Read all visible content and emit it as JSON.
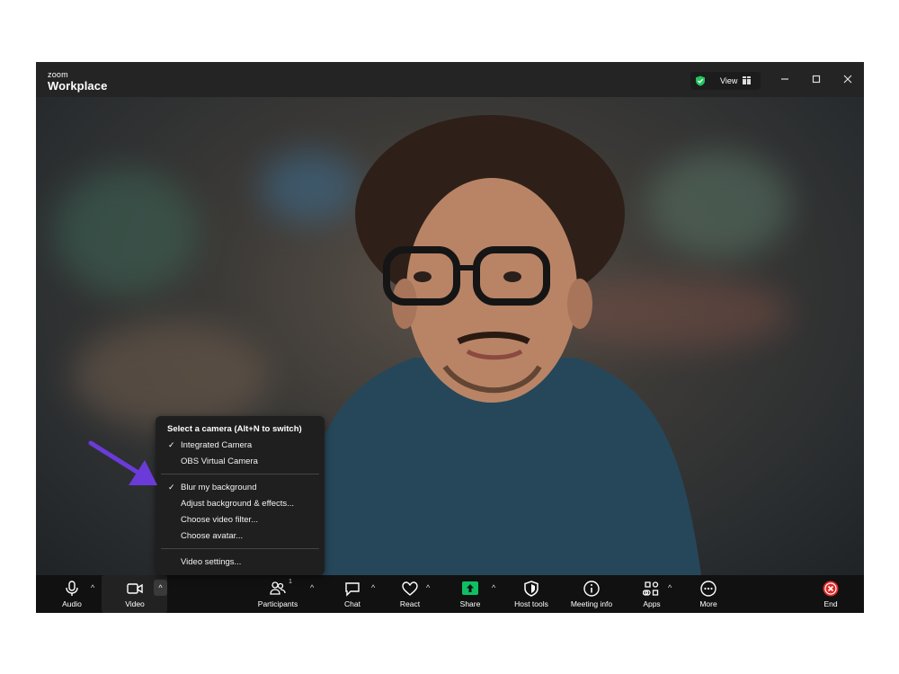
{
  "app": {
    "logo_small": "zoom",
    "logo_big": "Workplace"
  },
  "titlebar": {
    "view_label": "View",
    "icons": [
      "shield-check-icon",
      "grid-icon",
      "minimize-icon",
      "maximize-icon",
      "close-icon"
    ]
  },
  "menu": {
    "header": "Select a camera (Alt+N to switch)",
    "cameras": [
      {
        "label": "Integrated Camera",
        "checked": true
      },
      {
        "label": "OBS Virtual Camera",
        "checked": false
      }
    ],
    "effects": [
      {
        "label": "Blur my background",
        "checked": true
      },
      {
        "label": "Adjust background & effects...",
        "checked": false
      },
      {
        "label": "Choose video filter...",
        "checked": false
      },
      {
        "label": "Choose avatar...",
        "checked": false
      }
    ],
    "settings": {
      "label": "Video settings..."
    },
    "check_glyph": "✓"
  },
  "toolbar": {
    "audio": "Audio",
    "video": "Video",
    "participants": "Participants",
    "participants_count": "1",
    "chat": "Chat",
    "react": "React",
    "share": "Share",
    "host_tools": "Host tools",
    "meeting_info": "Meeting info",
    "apps": "Apps",
    "more": "More",
    "end": "End",
    "caret_glyph": "^"
  },
  "colors": {
    "share_green": "#0fbf63",
    "end_red": "#e02828",
    "annotation_arrow": "#6b3bd9",
    "shield_green": "#22c55e"
  }
}
